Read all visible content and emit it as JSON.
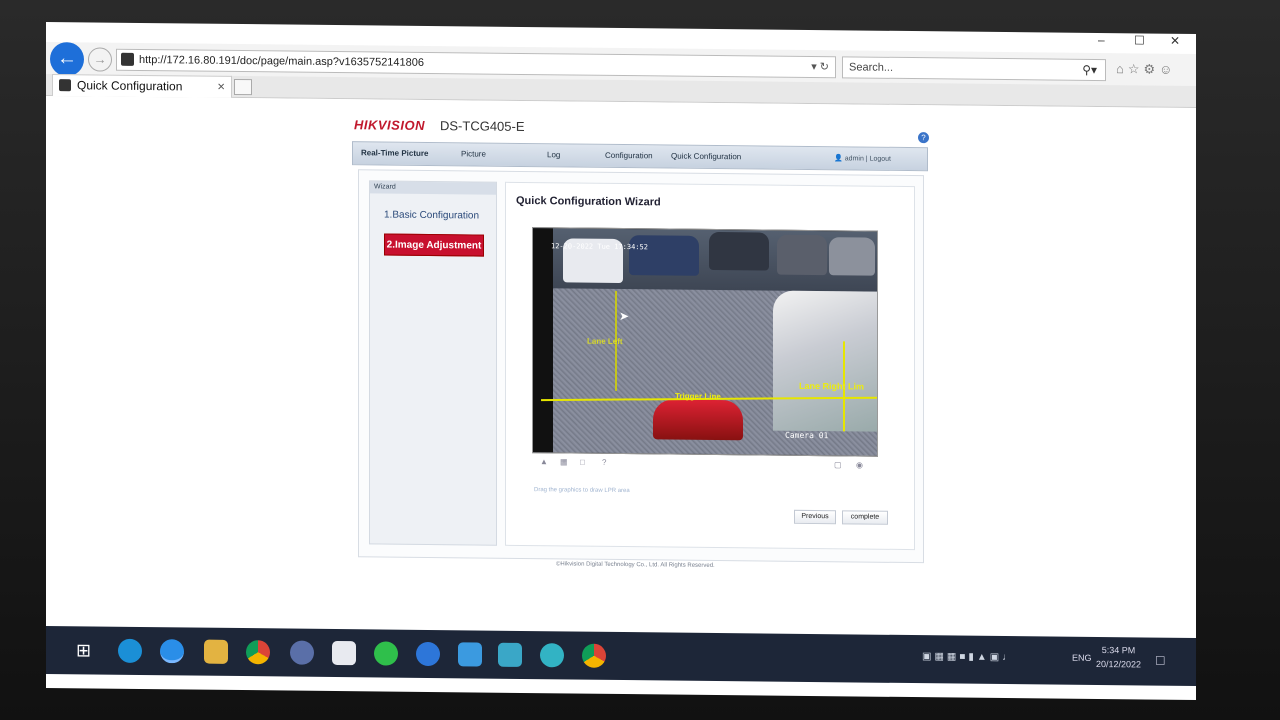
{
  "browser": {
    "url": "http://172.16.80.191/doc/page/main.asp?v1635752141806",
    "search_placeholder": "Search...",
    "tab_title": "Quick Configuration",
    "tab_close": "×",
    "win_min": "–",
    "win_max": "☐",
    "win_close": "✕"
  },
  "header": {
    "logo": "HIKVISION",
    "model": "DS-TCG405-E",
    "help_icon": "?"
  },
  "nav": {
    "items": [
      "Real-Time Picture",
      "Picture",
      "Log",
      "Configuration",
      "Quick Configuration"
    ],
    "user": "admin",
    "logout": "Logout"
  },
  "wizard": {
    "header": "Wizard",
    "step1": "1.Basic Configuration",
    "step2": "2.Image Adjustment",
    "title": "Quick Configuration Wizard"
  },
  "video": {
    "timestamp": "12-20-2022 Tue 17:34:52",
    "label_lane_left": "Lane Left",
    "label_lane_right": "Lane Right Lim",
    "label_trigger": "Trigger Line",
    "camera": "Camera 01"
  },
  "content": {
    "hint": "Drag the graphics to draw LPR area",
    "previous": "Previous",
    "complete": "complete"
  },
  "footer": {
    "copyright": "©Hikvision Digital Technology Co., Ltd. All Rights Reserved."
  },
  "taskbar": {
    "lang": "ENG",
    "time": "5:34 PM",
    "date": "20/12/2022"
  },
  "colors": {
    "accent": "#c8102e",
    "taskbar": "#1d2638",
    "browser_blue": "#1e6fd9"
  }
}
